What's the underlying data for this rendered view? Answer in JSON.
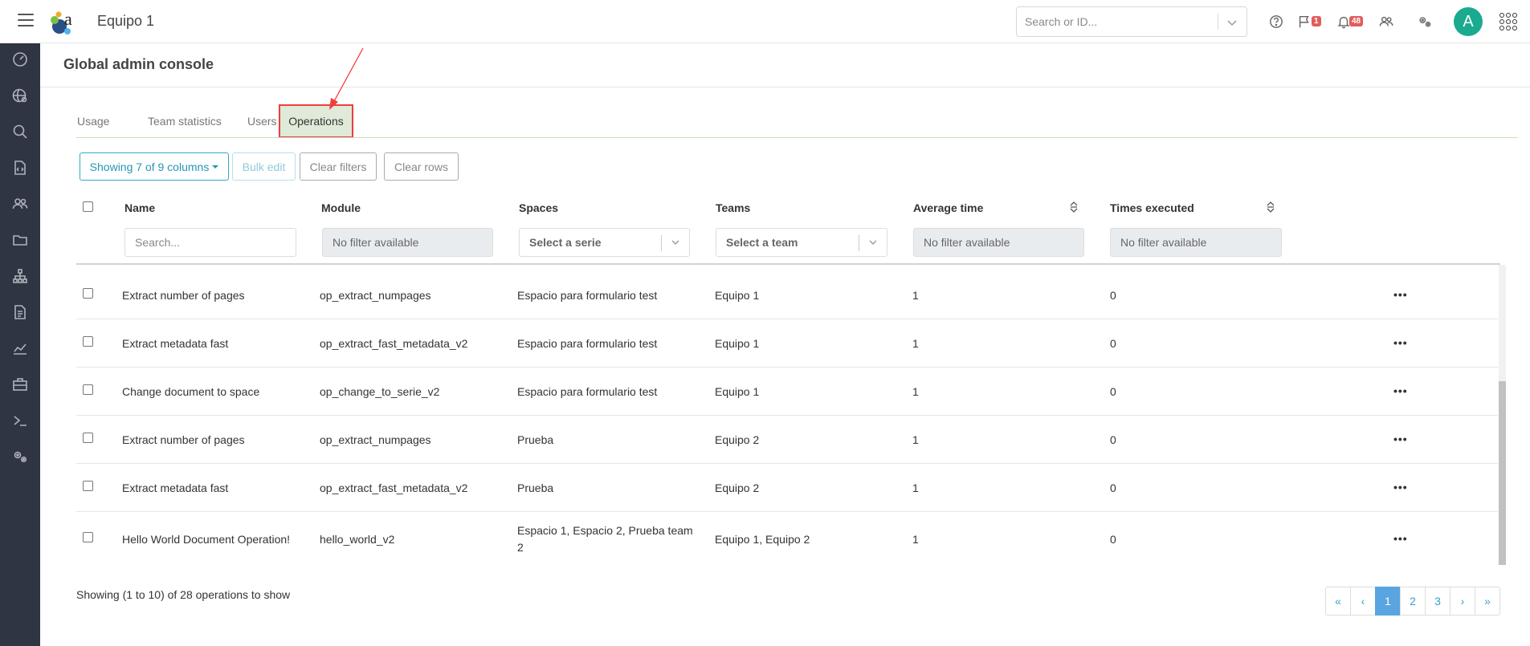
{
  "topbar": {
    "title": "Equipo 1",
    "search_placeholder": "Search or ID...",
    "flag_count": "1",
    "notif_count": "48",
    "avatar_letter": "A"
  },
  "page": {
    "title": "Global admin console"
  },
  "tabs": [
    {
      "label": "Usage"
    },
    {
      "label": "Team statistics"
    },
    {
      "label": "Users"
    },
    {
      "label": "Operations"
    }
  ],
  "toolbar": {
    "columns_label": "Showing 7 of 9 columns",
    "bulk_edit": "Bulk edit",
    "clear_filters": "Clear filters",
    "clear_rows": "Clear rows"
  },
  "table": {
    "headers": {
      "name": "Name",
      "module": "Module",
      "spaces": "Spaces",
      "teams": "Teams",
      "avg_time": "Average time",
      "times_executed": "Times executed"
    },
    "filters": {
      "name_placeholder": "Search...",
      "module": "No filter available",
      "spaces": "Select a serie",
      "teams": "Select a team",
      "avg_time": "No filter available",
      "times_executed": "No filter available"
    },
    "rows": [
      {
        "name": "Extract number of pages",
        "module": "op_extract_numpages",
        "spaces": "Espacio para formulario test",
        "teams": "Equipo 1",
        "avg": "1",
        "times": "0"
      },
      {
        "name": "Extract metadata fast",
        "module": "op_extract_fast_metadata_v2",
        "spaces": "Espacio para formulario test",
        "teams": "Equipo 1",
        "avg": "1",
        "times": "0"
      },
      {
        "name": "Change document to space",
        "module": "op_change_to_serie_v2",
        "spaces": "Espacio para formulario test",
        "teams": "Equipo 1",
        "avg": "1",
        "times": "0"
      },
      {
        "name": "Extract number of pages",
        "module": "op_extract_numpages",
        "spaces": "Prueba",
        "teams": "Equipo 2",
        "avg": "1",
        "times": "0"
      },
      {
        "name": "Extract metadata fast",
        "module": "op_extract_fast_metadata_v2",
        "spaces": "Prueba",
        "teams": "Equipo 2",
        "avg": "1",
        "times": "0"
      },
      {
        "name": "Hello World Document Operation!",
        "module": "hello_world_v2",
        "spaces_line1": "Espacio 1, Espacio 2, Prueba team",
        "spaces_line2": "2",
        "teams": "Equipo 1, Equipo 2",
        "avg": "1",
        "times": "0"
      }
    ],
    "row_menu": "•••"
  },
  "footer": {
    "summary": "Showing (1 to 10) of 28 operations to show",
    "pages": [
      "«",
      "‹",
      "1",
      "2",
      "3",
      "›",
      "»"
    ],
    "current_page": "1"
  },
  "colors": {
    "sidebar": "#2f3542",
    "accent": "#2498b6",
    "avatar": "#1aaa8f",
    "badge": "#e25c5c",
    "annotation": "#ef3d3d",
    "active_tab": "#dfead8"
  }
}
